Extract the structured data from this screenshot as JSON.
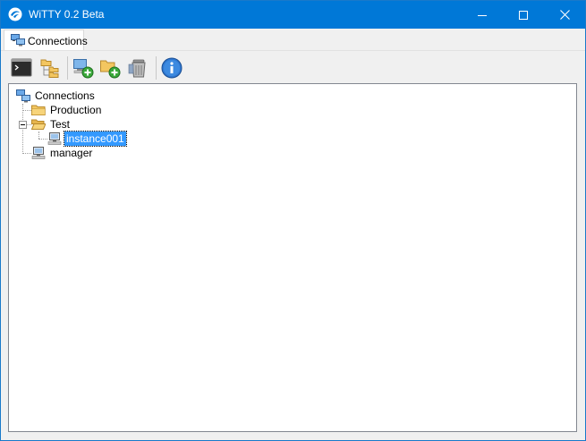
{
  "window": {
    "title": "WiTTY 0.2 Beta",
    "accent": "#0078d7"
  },
  "tabs": [
    {
      "label": "Connections",
      "icon": "connections-icon",
      "active": true
    }
  ],
  "toolbar": {
    "buttons": [
      {
        "name": "open-terminal-button",
        "icon": "terminal-icon"
      },
      {
        "name": "folder-tree-button",
        "icon": "folder-tree-icon"
      },
      {
        "name": "add-connection-button",
        "icon": "computer-add-icon"
      },
      {
        "name": "add-folder-button",
        "icon": "folder-add-icon"
      },
      {
        "name": "delete-button",
        "icon": "trash-icon"
      },
      {
        "name": "info-button",
        "icon": "info-icon"
      }
    ]
  },
  "tree": {
    "root": "Connections",
    "items": [
      {
        "label": "Production",
        "type": "folder"
      },
      {
        "label": "Test",
        "type": "folder",
        "expanded": true
      },
      {
        "label": "instance001",
        "type": "computer",
        "selected": true
      },
      {
        "label": "manager",
        "type": "computer"
      }
    ]
  }
}
